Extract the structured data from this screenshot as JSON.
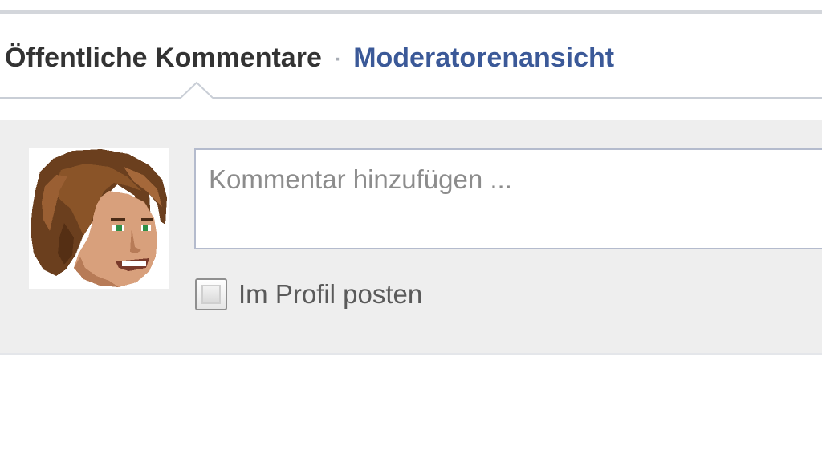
{
  "tabs": {
    "active_label": "Öffentliche Kommentare",
    "separator": "·",
    "link_label": "Moderatorenansicht"
  },
  "composer": {
    "avatar_icon": "user-avatar-icon",
    "input_placeholder": "Kommentar hinzufügen ...",
    "input_value": "",
    "post_to_profile_label": "Im Profil posten",
    "post_to_profile_checked": false
  },
  "colors": {
    "link": "#3b5998",
    "active_tab_text": "#333333",
    "composer_background": "#eeeeee",
    "input_border": "#b4bbcd"
  }
}
